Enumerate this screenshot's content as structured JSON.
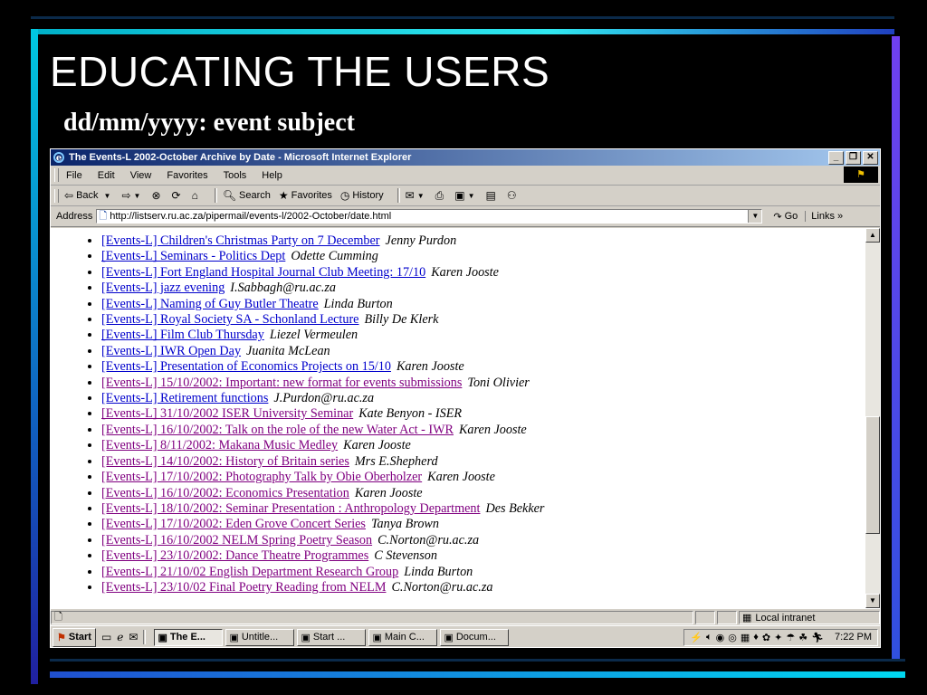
{
  "slide": {
    "title": "EDUCATING THE USERS",
    "subtitle": "dd/mm/yyyy: event subject"
  },
  "window": {
    "title": "The Events-L 2002-October Archive by Date - Microsoft Internet Explorer",
    "min": "_",
    "max": "❐",
    "close": "✕"
  },
  "menu": [
    "File",
    "Edit",
    "View",
    "Favorites",
    "Tools",
    "Help"
  ],
  "toolbar": {
    "back": "Back",
    "search": "Search",
    "favorites": "Favorites",
    "history": "History"
  },
  "address": {
    "label": "Address",
    "url": "http://listserv.ru.ac.za/pipermail/events-l/2002-October/date.html",
    "go": "Go",
    "links": "Links"
  },
  "events": [
    {
      "subject": "[Events-L] Children's Christmas Party on 7 December",
      "author": "Jenny Purdon",
      "visited": false
    },
    {
      "subject": "[Events-L] Seminars - Politics Dept",
      "author": "Odette Cumming",
      "visited": false
    },
    {
      "subject": "[Events-L] Fort England Hospital Journal Club Meeting: 17/10",
      "author": "Karen Jooste",
      "visited": false
    },
    {
      "subject": "[Events-L] jazz evening",
      "author": "I.Sabbagh@ru.ac.za",
      "visited": false
    },
    {
      "subject": "[Events-L] Naming of Guy Butler Theatre",
      "author": "Linda Burton",
      "visited": false
    },
    {
      "subject": "[Events-L] Royal Society SA - Schonland Lecture",
      "author": "Billy De Klerk",
      "visited": false
    },
    {
      "subject": "[Events-L] Film Club Thursday",
      "author": "Liezel Vermeulen",
      "visited": false
    },
    {
      "subject": "[Events-L] IWR Open Day",
      "author": "Juanita McLean",
      "visited": false
    },
    {
      "subject": "[Events-L] Presentation of Economics Projects on 15/10",
      "author": "Karen Jooste",
      "visited": false
    },
    {
      "subject": "[Events-L] 15/10/2002: Important: new format for events submissions",
      "author": "Toni Olivier",
      "visited": true
    },
    {
      "subject": "[Events-L] Retirement functions",
      "author": "J.Purdon@ru.ac.za",
      "visited": false
    },
    {
      "subject": "[Events-L] 31/10/2002 ISER University Seminar",
      "author": "Kate Benyon - ISER",
      "visited": true
    },
    {
      "subject": "[Events-L] 16/10/2002: Talk on the role of the new Water Act - IWR",
      "author": "Karen Jooste",
      "visited": true
    },
    {
      "subject": "[Events-L] 8/11/2002: Makana Music Medley",
      "author": "Karen Jooste",
      "visited": true
    },
    {
      "subject": "[Events-L] 14/10/2002: History of Britain series",
      "author": "Mrs E.Shepherd",
      "visited": true
    },
    {
      "subject": "[Events-L] 17/10/2002: Photography Talk by Obie Oberholzer",
      "author": "Karen Jooste",
      "visited": true
    },
    {
      "subject": "[Events-L] 16/10/2002: Economics Presentation",
      "author": "Karen Jooste",
      "visited": true
    },
    {
      "subject": "[Events-L] 18/10/2002: Seminar Presentation : Anthropology Department",
      "author": "Des Bekker",
      "visited": true
    },
    {
      "subject": "[Events-L] 17/10/2002: Eden Grove Concert Series",
      "author": "Tanya Brown",
      "visited": true
    },
    {
      "subject": "[Events-L] 16/10/2002 NELM Spring Poetry Season",
      "author": "C.Norton@ru.ac.za",
      "visited": true
    },
    {
      "subject": "[Events-L] 23/10/2002: Dance Theatre Programmes",
      "author": "C Stevenson",
      "visited": true
    },
    {
      "subject": "[Events-L] 21/10/02 English Department Research Group",
      "author": "Linda Burton",
      "visited": true
    },
    {
      "subject": "[Events-L] 23/10/02 Final Poetry Reading from NELM",
      "author": "C.Norton@ru.ac.za",
      "visited": true
    }
  ],
  "status": {
    "zone": "Local intranet"
  },
  "taskbar": {
    "start": "Start",
    "tasks": [
      {
        "label": "The E...",
        "active": true
      },
      {
        "label": "Untitle...",
        "active": false
      },
      {
        "label": "Start ...",
        "active": false
      },
      {
        "label": "Main C...",
        "active": false
      },
      {
        "label": "Docum...",
        "active": false
      }
    ],
    "clock": "7:22 PM"
  },
  "colors": {
    "link": "#0000cc",
    "visited": "#800080",
    "titlebar": "#0a246a"
  }
}
